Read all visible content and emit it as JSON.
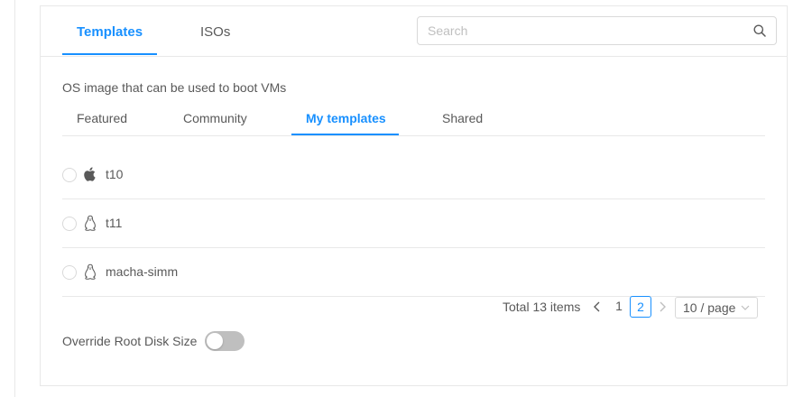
{
  "colors": {
    "accent": "#1890ff",
    "text": "#595959",
    "border": "#e8e8e8",
    "switch_off": "#bfbfbf"
  },
  "top_tabs": [
    {
      "label": "Templates",
      "active": true
    },
    {
      "label": "ISOs",
      "active": false
    }
  ],
  "search": {
    "placeholder": "Search",
    "value": "",
    "icon": "search-icon"
  },
  "description": "OS image that can be used to boot VMs",
  "sub_tabs": [
    {
      "label": "Featured",
      "active": false
    },
    {
      "label": "Community",
      "active": false
    },
    {
      "label": "My templates",
      "active": true
    },
    {
      "label": "Shared",
      "active": false
    }
  ],
  "templates": [
    {
      "name": "t10",
      "os_icon": "apple-icon",
      "selected": false
    },
    {
      "name": "t11",
      "os_icon": "linux-icon",
      "selected": false
    },
    {
      "name": "macha-simm",
      "os_icon": "linux-icon",
      "selected": false
    }
  ],
  "pagination": {
    "total_text": "Total 13 items",
    "pages": [
      "1",
      "2"
    ],
    "current_page": "2",
    "page_size": "10 / page"
  },
  "override_root_disk": {
    "label": "Override Root Disk Size",
    "enabled": false
  }
}
